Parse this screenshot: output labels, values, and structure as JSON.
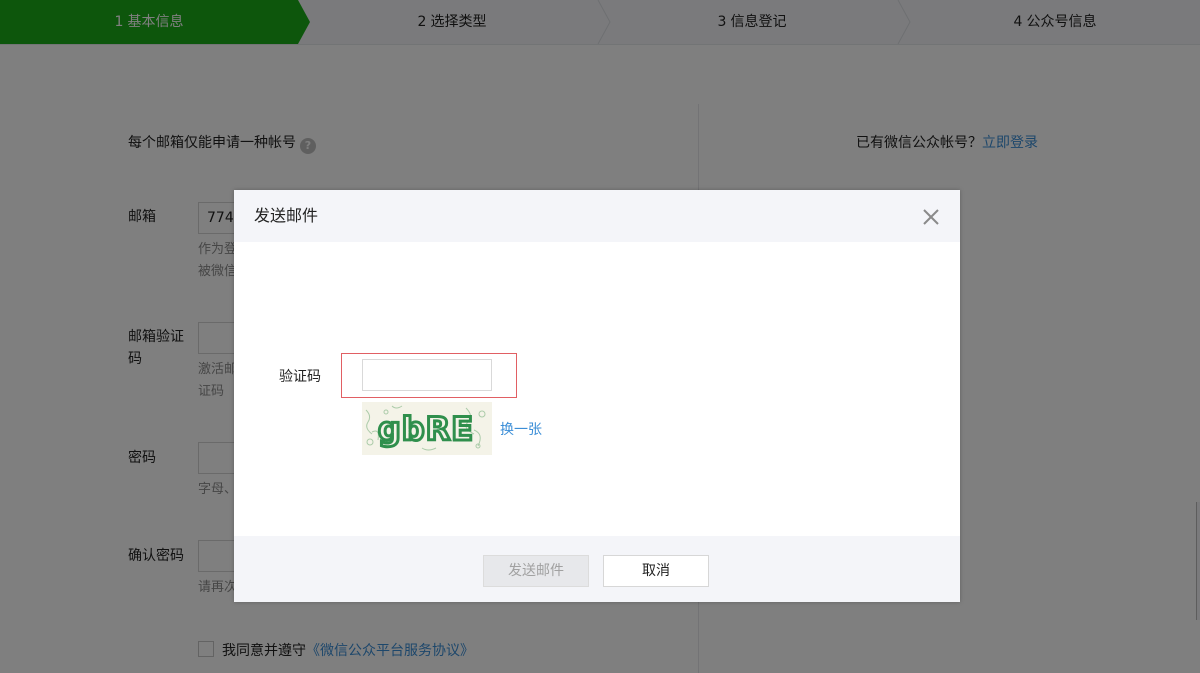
{
  "steps": [
    {
      "num": "1",
      "label": "基本信息"
    },
    {
      "num": "2",
      "label": "选择类型"
    },
    {
      "num": "3",
      "label": "信息登记"
    },
    {
      "num": "4",
      "label": "公众号信息"
    }
  ],
  "form": {
    "note": "每个邮箱仅能申请一种帐号",
    "login_prompt": "已有微信公众帐号？",
    "login_link": "立即登录",
    "email_label": "邮箱",
    "email_value": "774",
    "email_hint_1": "作为登",
    "email_hint_2": "被微信",
    "verify_label": "邮箱验证码",
    "verify_hint_1": "激活邮",
    "verify_hint_2": "证码",
    "password_label": "密码",
    "password_hint": "字母、",
    "confirm_label": "确认密码",
    "confirm_hint": "请再次",
    "agree_text": "我同意并遵守",
    "agree_link": "《微信公众平台服务协议》"
  },
  "dialog": {
    "title": "发送邮件",
    "captcha_label": "验证码",
    "captcha_value": "",
    "captcha_image_text": "gbRE",
    "refresh_label": "换一张",
    "send_button": "发送邮件",
    "cancel_button": "取消"
  },
  "colors": {
    "accent_green": "#1aad19",
    "link_blue": "#3b8ed7",
    "error_red": "#e15f63",
    "captcha_green": "#2f8f4c"
  }
}
